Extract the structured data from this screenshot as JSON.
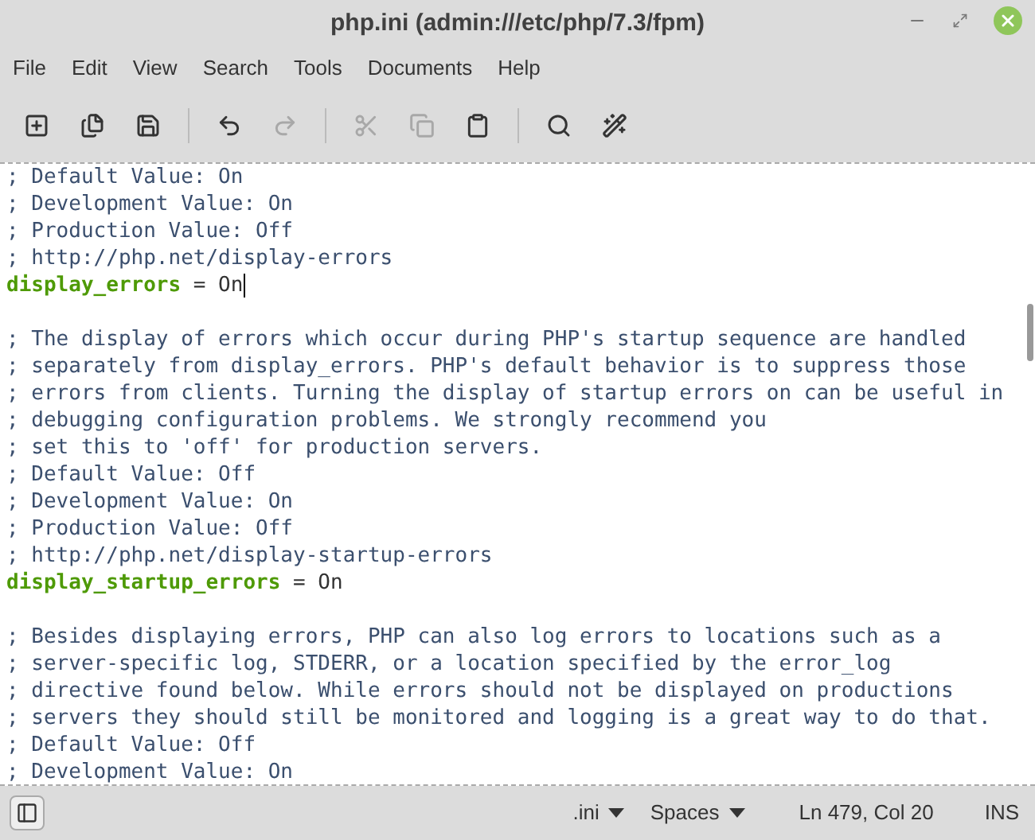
{
  "window": {
    "title": "php.ini (admin:///etc/php/7.3/fpm)"
  },
  "menu": [
    "File",
    "Edit",
    "View",
    "Search",
    "Tools",
    "Documents",
    "Help"
  ],
  "toolbar": {
    "groups": [
      [
        {
          "disabled": false
        },
        {
          "disabled": false
        },
        {
          "disabled": false
        }
      ],
      [
        {
          "disabled": false
        },
        {
          "disabled": true
        }
      ],
      [
        {
          "disabled": true
        },
        {
          "disabled": true
        },
        {
          "disabled": false
        }
      ],
      [
        {
          "disabled": false
        },
        {
          "disabled": false
        }
      ]
    ]
  },
  "editor": {
    "lines": [
      {
        "kind": "comment",
        "text": "; Default Value: On"
      },
      {
        "kind": "comment",
        "text": "; Development Value: On"
      },
      {
        "kind": "comment",
        "text": "; Production Value: Off"
      },
      {
        "kind": "comment",
        "text": "; http://php.net/display-errors"
      },
      {
        "kind": "setting",
        "key": "display_errors",
        "rest": " = On",
        "cursor": true
      },
      {
        "kind": "blank"
      },
      {
        "kind": "comment",
        "text": "; The display of errors which occur during PHP's startup sequence are handled"
      },
      {
        "kind": "comment",
        "text": "; separately from display_errors. PHP's default behavior is to suppress those"
      },
      {
        "kind": "comment",
        "text": "; errors from clients. Turning the display of startup errors on can be useful in"
      },
      {
        "kind": "comment",
        "text": "; debugging configuration problems. We strongly recommend you"
      },
      {
        "kind": "comment",
        "text": "; set this to 'off' for production servers."
      },
      {
        "kind": "comment",
        "text": "; Default Value: Off"
      },
      {
        "kind": "comment",
        "text": "; Development Value: On"
      },
      {
        "kind": "comment",
        "text": "; Production Value: Off"
      },
      {
        "kind": "comment",
        "text": "; http://php.net/display-startup-errors"
      },
      {
        "kind": "setting",
        "key": "display_startup_errors",
        "rest": " = On",
        "cursor": false
      },
      {
        "kind": "blank"
      },
      {
        "kind": "comment",
        "text": "; Besides displaying errors, PHP can also log errors to locations such as a"
      },
      {
        "kind": "comment",
        "text": "; server-specific log, STDERR, or a location specified by the error_log"
      },
      {
        "kind": "comment",
        "text": "; directive found below. While errors should not be displayed on productions"
      },
      {
        "kind": "comment",
        "text": "; servers they should still be monitored and logging is a great way to do that."
      },
      {
        "kind": "comment",
        "text": "; Default Value: Off"
      },
      {
        "kind": "comment",
        "text": "; Development Value: On"
      }
    ]
  },
  "status_bar": {
    "language": ".ini",
    "indent": "Spaces",
    "position": "Ln 479, Col 20",
    "mode": "INS"
  }
}
